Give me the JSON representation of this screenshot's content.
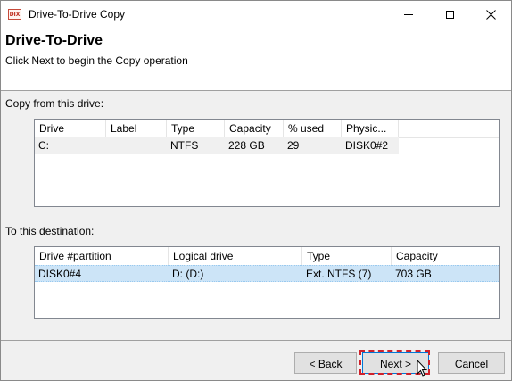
{
  "window": {
    "title": "Drive-To-Drive Copy",
    "icon_name": "disk-icon",
    "icon_text": "DIX"
  },
  "header": {
    "title": "Drive-To-Drive",
    "subtitle": "Click Next to begin the Copy operation"
  },
  "source": {
    "label": "Copy from this drive:",
    "columns": [
      "Drive",
      "Label",
      "Type",
      "Capacity",
      "% used",
      "Physic..."
    ],
    "rows": [
      [
        "C:",
        "",
        "NTFS",
        "228 GB",
        "29",
        "DISK0#2"
      ]
    ]
  },
  "destination": {
    "label": "To this destination:",
    "columns": [
      "Drive #partition",
      "Logical drive",
      "Type",
      "Capacity"
    ],
    "rows": [
      [
        "DISK0#4",
        "D: (D:)",
        "Ext. NTFS (7)",
        "703 GB"
      ]
    ]
  },
  "buttons": {
    "back": "< Back",
    "next": "Next >",
    "cancel": "Cancel"
  },
  "colors": {
    "selection": "#cce4f7",
    "highlight": "#d0202a"
  }
}
